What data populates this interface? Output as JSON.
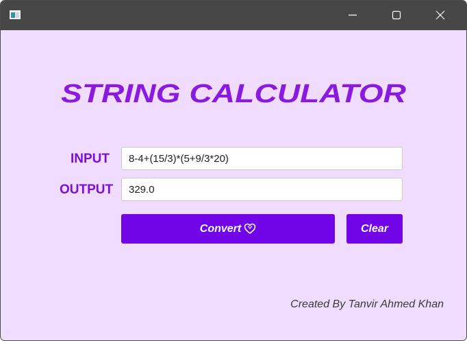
{
  "window": {
    "app_icon": "window-app-icon",
    "controls": {
      "minimize_icon": "minimize-icon",
      "maximize_icon": "maximize-icon",
      "close_icon": "close-icon"
    }
  },
  "main": {
    "title": "STRING CALCULATOR",
    "input_label": "INPUT",
    "input_value": "8-4+(15/3)*(5+9/3*20)",
    "output_label": "OUTPUT",
    "output_value": "329.0",
    "convert_label": "Convert",
    "convert_icon": "heart-icon",
    "clear_label": "Clear",
    "credit": "Created By Tanvir Ahmed Khan"
  },
  "colors": {
    "background": "#efdcff",
    "accent": "#7205e8",
    "title": "#8a1ae0",
    "label": "#7a0fd8",
    "titlebar": "#474747"
  }
}
